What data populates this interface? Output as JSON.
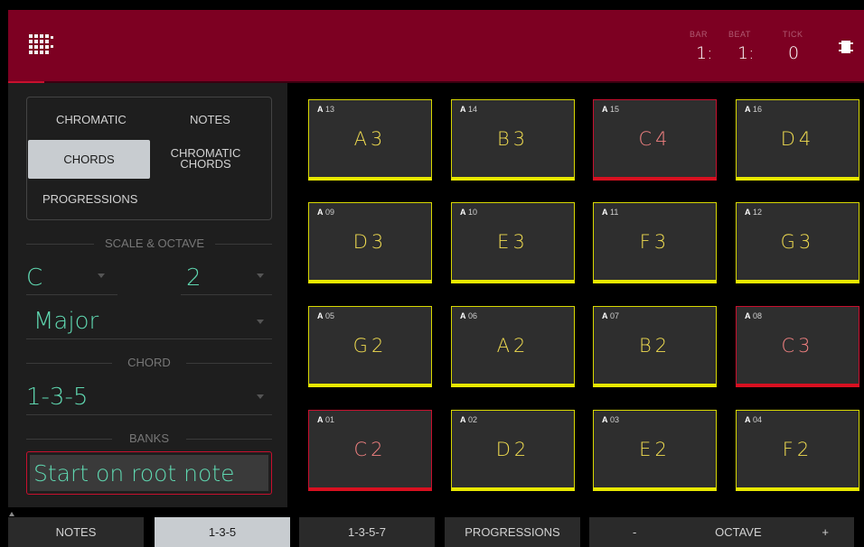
{
  "header": {
    "bar_label": "BAR",
    "beat_label": "BEAT",
    "tick_label": "TICK",
    "bar_value": "1:",
    "beat_value": "1:",
    "tick_value": "0"
  },
  "modes": {
    "chromatic": "CHROMATIC",
    "notes": "NOTES",
    "chords": "CHORDS",
    "chromatic_chords_1": "CHROMATIC",
    "chromatic_chords_2": "CHORDS",
    "progressions": "PROGRESSIONS",
    "active": "CHORDS"
  },
  "scale_octave": {
    "label": "SCALE & OCTAVE",
    "root": "C",
    "octave": "2",
    "scale": "Major"
  },
  "chord": {
    "label": "CHORD",
    "value": "1-3-5"
  },
  "banks": {
    "label": "BANKS",
    "value": "Start on root note"
  },
  "pads": [
    {
      "bank": "A",
      "num": "13",
      "note": "A3",
      "root": false
    },
    {
      "bank": "A",
      "num": "14",
      "note": "B3",
      "root": false
    },
    {
      "bank": "A",
      "num": "15",
      "note": "C4",
      "root": true
    },
    {
      "bank": "A",
      "num": "16",
      "note": "D4",
      "root": false
    },
    {
      "bank": "A",
      "num": "09",
      "note": "D3",
      "root": false
    },
    {
      "bank": "A",
      "num": "10",
      "note": "E3",
      "root": false
    },
    {
      "bank": "A",
      "num": "11",
      "note": "F3",
      "root": false
    },
    {
      "bank": "A",
      "num": "12",
      "note": "G3",
      "root": false
    },
    {
      "bank": "A",
      "num": "05",
      "note": "G2",
      "root": false
    },
    {
      "bank": "A",
      "num": "06",
      "note": "A2",
      "root": false
    },
    {
      "bank": "A",
      "num": "07",
      "note": "B2",
      "root": false
    },
    {
      "bank": "A",
      "num": "08",
      "note": "C3",
      "root": true
    },
    {
      "bank": "A",
      "num": "01",
      "note": "C2",
      "root": true
    },
    {
      "bank": "A",
      "num": "02",
      "note": "D2",
      "root": false
    },
    {
      "bank": "A",
      "num": "03",
      "note": "E2",
      "root": false
    },
    {
      "bank": "A",
      "num": "04",
      "note": "F2",
      "root": false
    }
  ],
  "bottom": {
    "notes": "NOTES",
    "chord_135": "1-3-5",
    "chord_1357": "1-3-5-7",
    "progressions": "PROGRESSIONS",
    "octave_minus": "-",
    "octave_label": "OCTAVE",
    "octave_plus": "+"
  },
  "colors": {
    "header": "#7d0022",
    "accent_red": "#c8102e",
    "pad_yellow": "#e8e800",
    "value_teal": "#5fd7b0"
  }
}
